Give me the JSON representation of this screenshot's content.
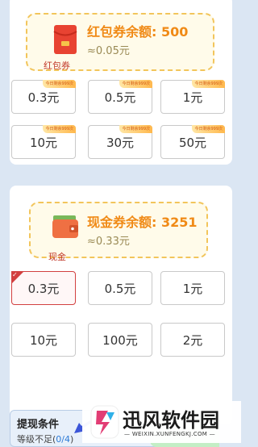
{
  "coupon": {
    "title": "红包券余额: 500",
    "approx": "≈0.05元",
    "icon": "red-envelope-icon",
    "icon_label": "红包券",
    "options": [
      {
        "label": "0.3元",
        "tag": "今日剩余999次"
      },
      {
        "label": "0.5元",
        "tag": "今日剩余999次"
      },
      {
        "label": "1元",
        "tag": "今日剩余999次"
      },
      {
        "label": "10元",
        "tag": "今日剩余999次"
      },
      {
        "label": "30元",
        "tag": "今日剩余999次"
      },
      {
        "label": "50元",
        "tag": "今日剩余999次"
      }
    ]
  },
  "cash": {
    "title": "现金券余额: 3251",
    "approx": "≈0.33元",
    "icon": "wallet-icon",
    "icon_label": "现金",
    "selected_index": 0,
    "options": [
      {
        "label": "0.3元"
      },
      {
        "label": "0.5元"
      },
      {
        "label": "1元"
      },
      {
        "label": "10元"
      },
      {
        "label": "100元"
      },
      {
        "label": "2元"
      }
    ]
  },
  "conditions": {
    "title": "提现条件",
    "level_prefix": "等级不足(",
    "level_progress": "0/4",
    "level_suffix": ")"
  },
  "watermark": {
    "name": "迅风软件园",
    "url": "— WEIXIN.XUNFENGKJ.COM —"
  },
  "colors": {
    "accent_orange": "#f08a16",
    "selected_red": "#d24040",
    "annotation_arrow": "#3b55d8"
  }
}
